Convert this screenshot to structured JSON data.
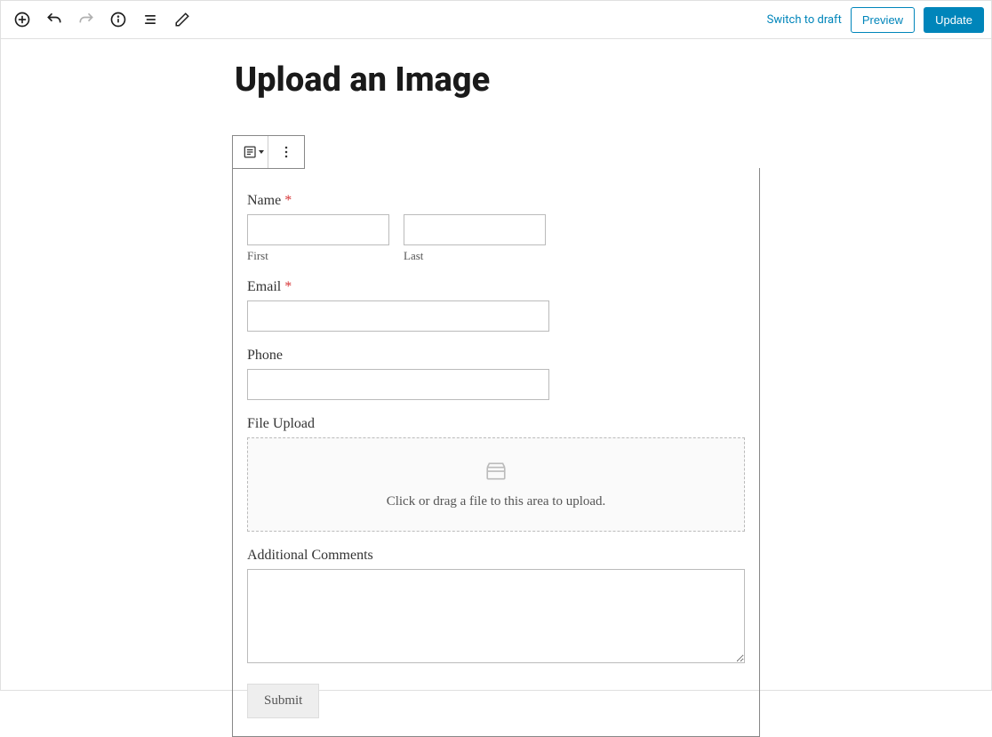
{
  "toolbar": {
    "switch_to_draft": "Switch to draft",
    "preview": "Preview",
    "update": "Update"
  },
  "page": {
    "title": "Upload an Image"
  },
  "form": {
    "name": {
      "label": "Name",
      "first_sublabel": "First",
      "last_sublabel": "Last"
    },
    "email": {
      "label": "Email"
    },
    "phone": {
      "label": "Phone"
    },
    "file_upload": {
      "label": "File Upload",
      "hint": "Click or drag a file to this area to upload."
    },
    "comments": {
      "label": "Additional Comments"
    },
    "submit": "Submit",
    "required_mark": "*"
  }
}
